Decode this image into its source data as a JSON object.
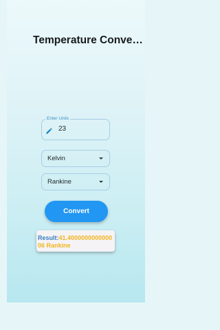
{
  "app": {
    "title": "Temperature Conver…"
  },
  "units_input": {
    "label": "Enter Units",
    "value": "23",
    "icon": "pencil-icon"
  },
  "from_unit": {
    "selected": "Kelvin"
  },
  "to_unit": {
    "selected": "Rankine"
  },
  "convert": {
    "label": "Convert"
  },
  "result": {
    "label": "Result:",
    "value": "41.400000000000006 Rankine"
  },
  "colors": {
    "accent": "#2196f3",
    "result_label": "#3a7fc0",
    "result_value": "#f2b51f",
    "border": "#a7cde6"
  }
}
